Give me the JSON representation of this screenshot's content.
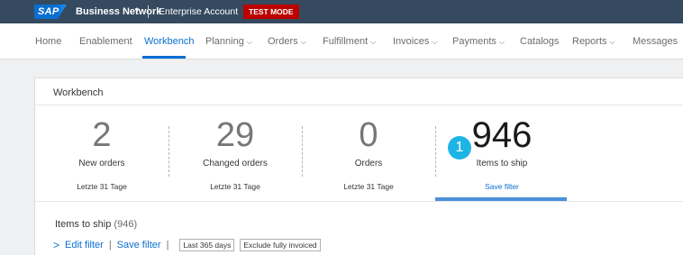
{
  "topbar": {
    "logo": "SAP",
    "app_title": "Business Network",
    "account": "Enterprise Account",
    "mode_badge": "TEST MODE"
  },
  "nav": {
    "items": [
      {
        "label": "Home",
        "has_menu": false
      },
      {
        "label": "Enablement",
        "has_menu": false
      },
      {
        "label": "Workbench",
        "has_menu": false,
        "active": true
      },
      {
        "label": "Planning",
        "has_menu": true
      },
      {
        "label": "Orders",
        "has_menu": true
      },
      {
        "label": "Fulfillment",
        "has_menu": true
      },
      {
        "label": "Invoices",
        "has_menu": true
      },
      {
        "label": "Payments",
        "has_menu": true
      },
      {
        "label": "Catalogs",
        "has_menu": false
      },
      {
        "label": "Reports",
        "has_menu": true
      },
      {
        "label": "Messages",
        "has_menu": false
      }
    ]
  },
  "workbench": {
    "title": "Workbench",
    "tiles": [
      {
        "value": "2",
        "label": "New orders",
        "period": "Letzte 31 Tage"
      },
      {
        "value": "29",
        "label": "Changed orders",
        "period": "Letzte 31 Tage"
      },
      {
        "value": "0",
        "label": "Orders",
        "period": "Letzte 31 Tage"
      },
      {
        "value": "946",
        "label": "Items to ship",
        "period": "Save filter",
        "selected": true
      }
    ],
    "step_badge": "1",
    "section": {
      "title": "Items to ship",
      "count": "(946)",
      "edit_filter": "Edit filter",
      "save_filter": "Save filter",
      "chips": [
        "Last 365 days",
        "Exclude fully invoiced"
      ]
    }
  },
  "colors": {
    "accent": "#0a6ed1",
    "topbar": "#354a5f",
    "test_mode": "#bb0000",
    "badge": "#1fb4e6"
  }
}
